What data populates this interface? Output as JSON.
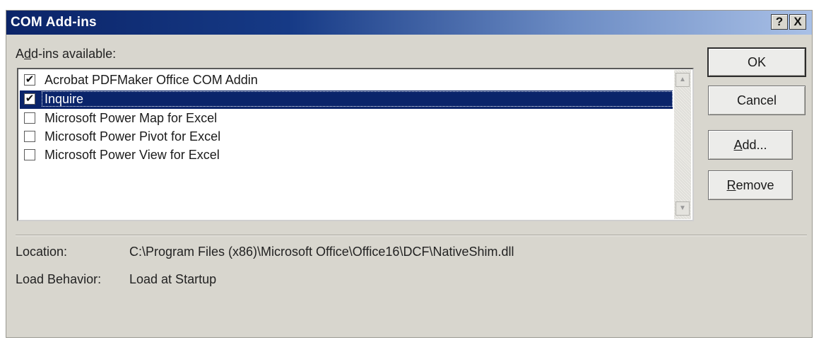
{
  "window": {
    "title": "COM Add-ins",
    "help_glyph": "?",
    "close_glyph": "X"
  },
  "addins": {
    "label_prefix": "A",
    "label_access": "d",
    "label_rest": "d-ins available:",
    "items": [
      {
        "label": "Acrobat PDFMaker Office COM Addin",
        "checked": true,
        "selected": false
      },
      {
        "label": "Inquire",
        "checked": true,
        "selected": true
      },
      {
        "label": "Microsoft Power Map for Excel",
        "checked": false,
        "selected": false
      },
      {
        "label": "Microsoft Power Pivot for Excel",
        "checked": false,
        "selected": false
      },
      {
        "label": "Microsoft Power View for Excel",
        "checked": false,
        "selected": false
      }
    ],
    "check_mark": "✔"
  },
  "buttons": {
    "ok": "OK",
    "cancel": "Cancel",
    "add_access": "A",
    "add_rest": "dd...",
    "remove_access": "R",
    "remove_rest": "emove"
  },
  "scroll": {
    "up_glyph": "▲",
    "down_glyph": "▼"
  },
  "details": {
    "location_label": "Location:",
    "location_value": "C:\\Program Files (x86)\\Microsoft Office\\Office16\\DCF\\NativeShim.dll",
    "load_label": "Load Behavior:",
    "load_value": "Load at Startup"
  },
  "colors": {
    "title_bar_start": "#0b2468",
    "title_bar_end": "#a9c0e6",
    "selection": "#0a246a",
    "dialog_bg": "#d8d6ce"
  }
}
